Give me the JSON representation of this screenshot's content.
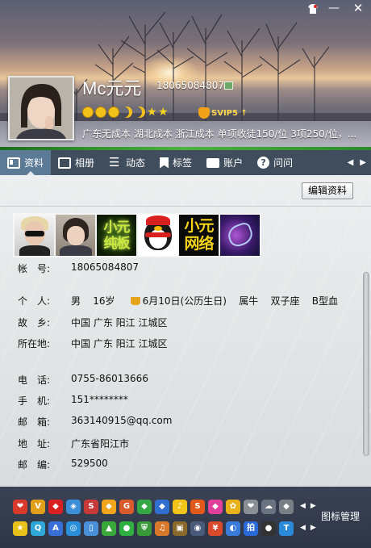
{
  "window": {
    "controls": {
      "skin_icon": "shirt-icon",
      "minimize": "—",
      "close": "✕"
    }
  },
  "profile": {
    "nickname": "Mc元元",
    "qq_number": "18065084807",
    "signature": "广东无成本 湖北成本 浙江成本 单项收徒150/位 3项250/位，...",
    "svip_label": "SVIP5 ↑",
    "level_icons": [
      "sun-icon",
      "sun-icon",
      "sun-icon",
      "moon-icon",
      "moon-icon",
      "star-icon",
      "star-icon"
    ]
  },
  "tabs": [
    {
      "label": "资料",
      "icon": "profile-card-icon",
      "active": true
    },
    {
      "label": "相册",
      "icon": "album-icon"
    },
    {
      "label": "动态",
      "icon": "feed-list-icon"
    },
    {
      "label": "标签",
      "icon": "tag-icon"
    },
    {
      "label": "账户",
      "icon": "wallet-icon"
    },
    {
      "label": "问问",
      "icon": "question-icon"
    }
  ],
  "edit_button": "编辑资料",
  "photo_wall": {
    "photos": [
      {
        "icon": "photo-boy-sunglasses"
      },
      {
        "icon": "photo-girl"
      },
      {
        "icon": "photo-text-art",
        "text": "小元\n纯板"
      },
      {
        "icon": "photo-qq-penguin"
      },
      {
        "icon": "photo-text-art",
        "text": "小元\n网络"
      },
      {
        "icon": "photo-purple-spark"
      }
    ]
  },
  "info": {
    "account": {
      "label": "帐　号:",
      "value": "18065084807"
    },
    "personal": {
      "label": "个　人:",
      "gender": "男",
      "age": "16岁",
      "birthday": "6月10日(公历生日)",
      "zodiac": "属牛",
      "constellation": "双子座",
      "blood_type": "B型血"
    },
    "hometown": {
      "label": "故　乡:",
      "value": "中国 广东 阳江 江城区"
    },
    "location": {
      "label": "所在地:",
      "value": "中国 广东 阳江 江城区"
    },
    "phone": {
      "label": "电　话:",
      "value": "0755-86013666"
    },
    "mobile": {
      "label": "手　机:",
      "value": "151********"
    },
    "email": {
      "label": "邮　箱:",
      "value": "363140915@qq.com"
    },
    "address": {
      "label": "地　址:",
      "value": "广东省阳江市"
    },
    "postcode": {
      "label": "邮　编:",
      "value": "529500"
    }
  },
  "icon_bar": {
    "manage_label": "图标管理",
    "row1": [
      {
        "name": "heart-gift-icon",
        "color": "#d93a2b",
        "glyph": "❤"
      },
      {
        "name": "vip-icon",
        "color": "#e2a01a",
        "glyph": "V"
      },
      {
        "name": "red-diamond-icon",
        "color": "#d92020",
        "glyph": "◆"
      },
      {
        "name": "game-icon",
        "color": "#3a8fd8",
        "glyph": "◈"
      },
      {
        "name": "qq-show-icon",
        "color": "#c83a3a",
        "glyph": "S"
      },
      {
        "name": "yellow-diamond-icon",
        "color": "#f0a51a",
        "glyph": "◆"
      },
      {
        "name": "game-diamond-icon",
        "color": "#d95a2a",
        "glyph": "G"
      },
      {
        "name": "green-diamond-icon",
        "color": "#35a845",
        "glyph": "◆"
      },
      {
        "name": "blue-diamond-icon",
        "color": "#2f6fd0",
        "glyph": "◆"
      },
      {
        "name": "qq-music-icon",
        "color": "#f2c41a",
        "glyph": "♪"
      },
      {
        "name": "super-vip-icon",
        "color": "#e25a1a",
        "glyph": "S"
      },
      {
        "name": "pink-diamond-icon",
        "color": "#e0409a",
        "glyph": "◆"
      },
      {
        "name": "qq-pet-icon",
        "color": "#e8b21a",
        "glyph": "✿"
      },
      {
        "name": "grey-heart-icon",
        "color": "#8a8f96",
        "glyph": "❤"
      },
      {
        "name": "cloud-icon",
        "color": "#6b7280",
        "glyph": "☁"
      },
      {
        "name": "grey-diamond-icon",
        "color": "#7a7f86",
        "glyph": "◆"
      }
    ],
    "row2": [
      {
        "name": "star-icon",
        "color": "#e8c21a",
        "glyph": "★"
      },
      {
        "name": "qq-game-icon",
        "color": "#2fa8d8",
        "glyph": "Q"
      },
      {
        "name": "app-icon",
        "color": "#3a6fd8",
        "glyph": "A"
      },
      {
        "name": "qzone-icon",
        "color": "#2a8fd8",
        "glyph": "◎"
      },
      {
        "name": "mobile-qq-icon",
        "color": "#4a90d9",
        "glyph": "▯"
      },
      {
        "name": "speed-icon",
        "color": "#3aa83a",
        "glyph": "▲"
      },
      {
        "name": "chat-bubble-icon",
        "color": "#2fb040",
        "glyph": "●"
      },
      {
        "name": "shield-icon",
        "color": "#3a9a3a",
        "glyph": "⛨"
      },
      {
        "name": "music-icon",
        "color": "#d8782a",
        "glyph": "♫"
      },
      {
        "name": "box-icon",
        "color": "#8a6a2a",
        "glyph": "▣"
      },
      {
        "name": "eye-icon",
        "color": "#4a5a7a",
        "glyph": "◉"
      },
      {
        "name": "wallet-icon",
        "color": "#d84a2a",
        "glyph": "¥"
      },
      {
        "name": "camera-icon",
        "color": "#3a7ad8",
        "glyph": "◐"
      },
      {
        "name": "paipai-icon",
        "color": "#2a6ad8",
        "glyph": "拍"
      },
      {
        "name": "penguin-icon",
        "color": "#333333",
        "glyph": "●"
      },
      {
        "name": "security-icon",
        "color": "#2a8ad8",
        "glyph": "T"
      },
      {
        "name": "doc-icon",
        "color": "#d8c83a",
        "glyph": "≡"
      },
      {
        "name": "mail-icon",
        "color": "#5a7ad8",
        "glyph": "✉"
      }
    ]
  }
}
